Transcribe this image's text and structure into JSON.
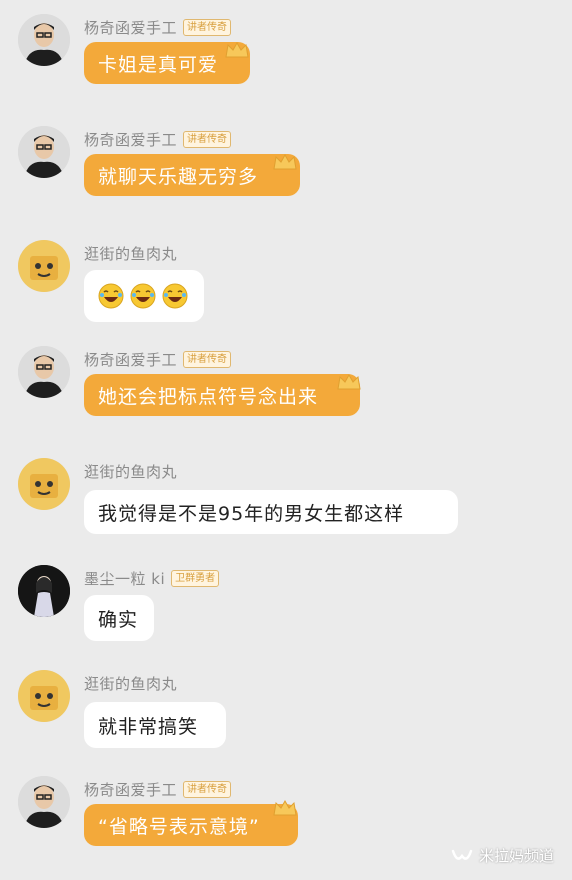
{
  "messages": [
    {
      "sender": "杨奇函爱手工",
      "badge": "讲者传奇",
      "text": "卡姐是真可爱",
      "style": "gold"
    },
    {
      "sender": "杨奇函爱手工",
      "badge": "讲者传奇",
      "text": "就聊天乐趣无穷多",
      "style": "gold"
    },
    {
      "sender": "逛街的鱼肉丸",
      "badge": "",
      "text": "",
      "style": "white",
      "emoji": [
        "laughing-face-icon",
        "laughing-face-icon",
        "laughing-face-icon"
      ]
    },
    {
      "sender": "杨奇函爱手工",
      "badge": "讲者传奇",
      "text": "她还会把标点符号念出来",
      "style": "gold"
    },
    {
      "sender": "逛街的鱼肉丸",
      "badge": "",
      "text": "我觉得是不是95年的男女生都这样",
      "style": "white"
    },
    {
      "sender": "墨尘一粒 ki",
      "badge": "卫群勇者",
      "text": "确实",
      "style": "white"
    },
    {
      "sender": "逛街的鱼肉丸",
      "badge": "",
      "text": "就非常搞笑",
      "style": "white"
    },
    {
      "sender": "杨奇函爱手工",
      "badge": "讲者传奇",
      "text": "“省略号表示意境”",
      "style": "gold"
    }
  ],
  "watermark": {
    "text": "米拉妈频道",
    "icon": "wechat-channel-icon"
  },
  "colors": {
    "gold_bubble": "#f3a93a",
    "white_bubble": "#ffffff",
    "background": "#ebebeb",
    "badge": "#d8a040"
  }
}
